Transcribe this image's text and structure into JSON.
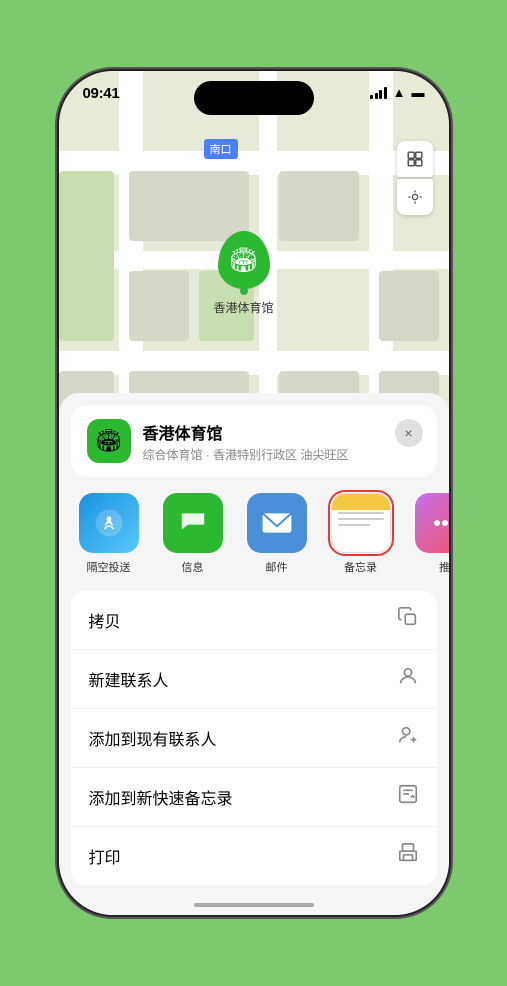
{
  "phone": {
    "status_bar": {
      "time": "09:41",
      "signal_icon": "signal",
      "wifi_icon": "wifi",
      "battery_icon": "battery"
    },
    "map": {
      "label_text": "南口",
      "marker_name": "香港体育馆"
    },
    "location_card": {
      "name": "香港体育馆",
      "description": "综合体育馆 · 香港特别行政区 油尖旺区",
      "close_label": "×"
    },
    "share_items": [
      {
        "id": "airdrop",
        "label": "隔空投送",
        "type": "airdrop"
      },
      {
        "id": "message",
        "label": "信息",
        "type": "message"
      },
      {
        "id": "mail",
        "label": "邮件",
        "type": "mail"
      },
      {
        "id": "notes",
        "label": "备忘录",
        "type": "notes",
        "selected": true
      },
      {
        "id": "more",
        "label": "推",
        "type": "more"
      }
    ],
    "actions": [
      {
        "id": "copy",
        "label": "拷贝",
        "icon": "copy"
      },
      {
        "id": "new-contact",
        "label": "新建联系人",
        "icon": "person"
      },
      {
        "id": "add-existing",
        "label": "添加到现有联系人",
        "icon": "person-add"
      },
      {
        "id": "add-note",
        "label": "添加到新快速备忘录",
        "icon": "note"
      }
    ],
    "partial_action": "打印"
  }
}
